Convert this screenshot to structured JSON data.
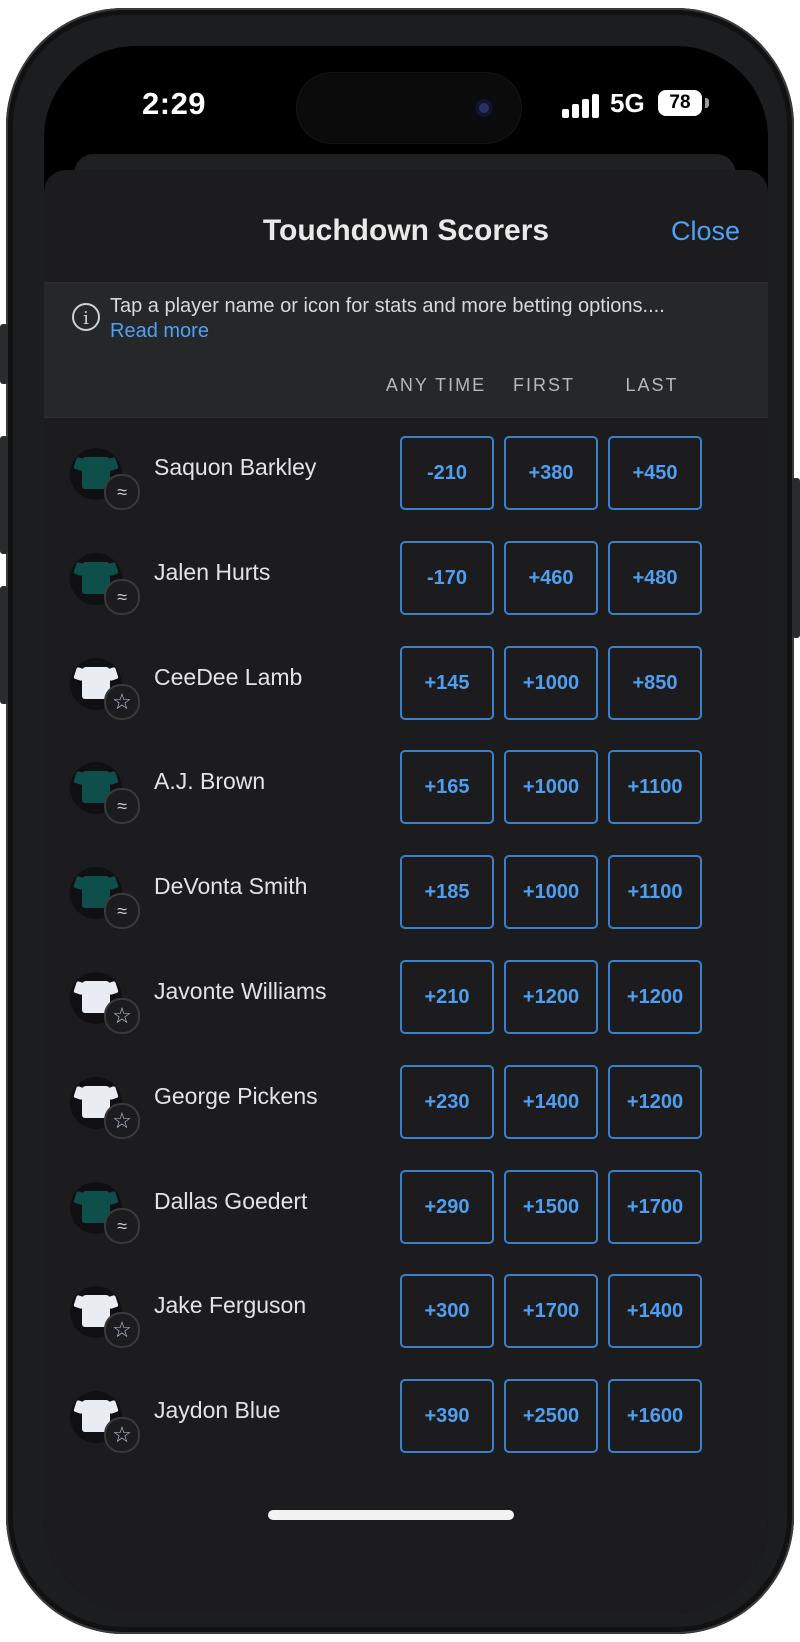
{
  "status_bar": {
    "time": "2:29",
    "network": "5G",
    "battery": "78"
  },
  "header": {
    "title": "Touchdown Scorers",
    "close_label": "Close"
  },
  "info": {
    "text": "Tap a player name or icon for stats and more betting options....",
    "link": "Read more",
    "icon": "info-icon"
  },
  "columns": [
    "ANY TIME",
    "FIRST",
    "LAST"
  ],
  "players": [
    {
      "name": "Saquon Barkley",
      "team": "eagles",
      "odds": [
        "-210",
        "+380",
        "+450"
      ]
    },
    {
      "name": "Jalen Hurts",
      "team": "eagles",
      "odds": [
        "-170",
        "+460",
        "+480"
      ]
    },
    {
      "name": "CeeDee Lamb",
      "team": "cowboys",
      "odds": [
        "+145",
        "+1000",
        "+850"
      ]
    },
    {
      "name": "A.J. Brown",
      "team": "eagles",
      "odds": [
        "+165",
        "+1000",
        "+1100"
      ]
    },
    {
      "name": "DeVonta Smith",
      "team": "eagles",
      "odds": [
        "+185",
        "+1000",
        "+1100"
      ]
    },
    {
      "name": "Javonte Williams",
      "team": "cowboys",
      "odds": [
        "+210",
        "+1200",
        "+1200"
      ]
    },
    {
      "name": "George Pickens",
      "team": "cowboys",
      "odds": [
        "+230",
        "+1400",
        "+1200"
      ]
    },
    {
      "name": "Dallas Goedert",
      "team": "eagles",
      "odds": [
        "+290",
        "+1500",
        "+1700"
      ]
    },
    {
      "name": "Jake Ferguson",
      "team": "cowboys",
      "odds": [
        "+300",
        "+1700",
        "+1400"
      ]
    },
    {
      "name": "Jaydon Blue",
      "team": "cowboys",
      "odds": [
        "+390",
        "+2500",
        "+1600"
      ]
    }
  ],
  "colors": {
    "accent": "#4ea2f5",
    "odds_border": "#3b80c8",
    "eagles_jersey": "#0e4f4c",
    "cowboys_jersey": "#e9ecf2",
    "sheet_bg": "#1c1c1e"
  }
}
